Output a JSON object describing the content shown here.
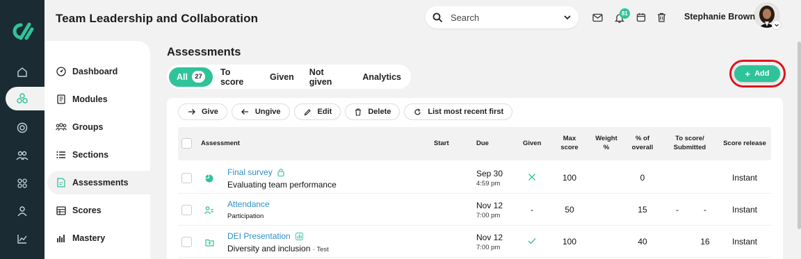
{
  "header": {
    "title": "Team Leadership and Collaboration",
    "search_label": "Search",
    "notification_count": "81",
    "user_name": "Stephanie Brown"
  },
  "sidebar": {
    "items": [
      {
        "label": "Dashboard",
        "icon": "dashboard-icon"
      },
      {
        "label": "Modules",
        "icon": "book-icon"
      },
      {
        "label": "Groups",
        "icon": "groups-icon"
      },
      {
        "label": "Sections",
        "icon": "list-icon"
      },
      {
        "label": "Assessments",
        "icon": "document-icon",
        "active": true
      },
      {
        "label": "Scores",
        "icon": "table-icon"
      },
      {
        "label": "Mastery",
        "icon": "bar-chart-icon"
      }
    ]
  },
  "main": {
    "section_title": "Assessments",
    "tabs": [
      {
        "label": "All",
        "count": "27",
        "active": true
      },
      {
        "label": "To score"
      },
      {
        "label": "Given"
      },
      {
        "label": "Not given"
      },
      {
        "label": "Analytics"
      }
    ],
    "add_label": "Add",
    "toolbar": {
      "give": "Give",
      "ungive": "Ungive",
      "edit": "Edit",
      "delete": "Delete",
      "sort": "List most recent first"
    },
    "columns": {
      "assessment": "Assessment",
      "start": "Start",
      "due": "Due",
      "given": "Given",
      "max_score_1": "Max",
      "max_score_2": "score",
      "weight_1": "Weight",
      "weight_2": "%",
      "pct_overall_1": "% of",
      "pct_overall_2": "overall",
      "to_score_1": "To score/",
      "to_score_2": "Submitted",
      "score_release": "Score release"
    },
    "rows": [
      {
        "title": "Final survey",
        "subtitle": "Evaluating team performance",
        "tag": "",
        "due_date": "Sep 30",
        "due_time": "4:59 pm",
        "given": "x",
        "max_score": "100",
        "pct_overall": "0",
        "to_score": "",
        "submitted": "",
        "release": "Instant"
      },
      {
        "title": "Attendance",
        "subtitle": "Participation",
        "tag": "",
        "due_date": "Nov 12",
        "due_time": "7:00 pm",
        "given": "-",
        "max_score": "50",
        "pct_overall": "15",
        "to_score": "-",
        "submitted": "-",
        "release": "Instant"
      },
      {
        "title": "DEI Presentation",
        "subtitle": "Diversity and inclusion",
        "tag": "· Test",
        "due_date": "Nov 12",
        "due_time": "7:00 pm",
        "given": "check",
        "max_score": "100",
        "pct_overall": "40",
        "to_score": "",
        "submitted": "16",
        "release": "Instant"
      }
    ]
  },
  "colors": {
    "accent": "#2fc39a",
    "rail": "#1b2b33",
    "link": "#2e8fc7",
    "highlight_ring": "#e0131c"
  }
}
